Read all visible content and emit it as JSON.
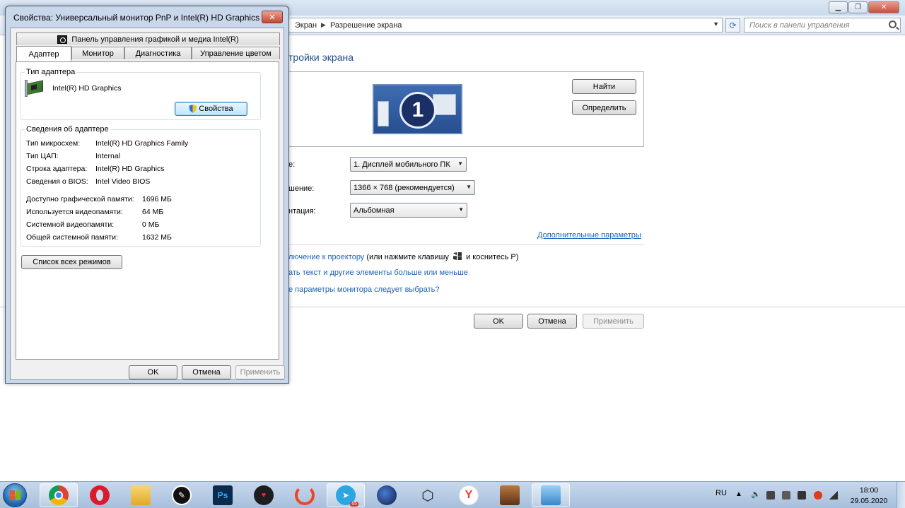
{
  "control_panel": {
    "breadcrumb": [
      "Экран",
      "Разрешение экрана"
    ],
    "search_placeholder": "Поиск в панели управления",
    "heading": "тройки экрана",
    "monitor_number": "1",
    "find_label": "Найти",
    "identify_label": "Определить",
    "display_label": "е:",
    "display_value": "1. Дисплей мобильного ПК",
    "resolution_label": "шение:",
    "resolution_value": "1366 × 768 (рекомендуется)",
    "orientation_label": "нтация:",
    "orientation_value": "Альбомная",
    "advanced_link": "Дополнительные параметры",
    "projector_link": "лючение к проектору",
    "projector_hint_before": "(или нажмите клавишу",
    "projector_hint_after": "и коснитесь P)",
    "text_size_link": "ать текст и другие элементы больше или меньше",
    "monitor_settings_link": "е параметры монитора следует выбрать?",
    "ok_label": "OK",
    "cancel_label": "Отмена",
    "apply_label": "Применить"
  },
  "dialog": {
    "title": "Свойства: Универсальный монитор PnP и Intel(R) HD Graphics",
    "close_label": "✕",
    "top_tab": "Панель управления графикой и медиа Intel(R)",
    "tabs": [
      "Адаптер",
      "Монитор",
      "Диагностика",
      "Управление цветом"
    ],
    "adapter_type_title": "Тип адаптера",
    "adapter_name": "Intel(R) HD Graphics",
    "properties_label": "Свойства",
    "adapter_info_title": "Сведения об адаптере",
    "info": [
      {
        "label": "Тип микросхем:",
        "value": "Intel(R) HD Graphics Family"
      },
      {
        "label": "Тип ЦАП:",
        "value": "Internal"
      },
      {
        "label": "Строка адаптера:",
        "value": "Intel(R) HD Graphics"
      },
      {
        "label": "Сведения о BIOS:",
        "value": "Intel Video BIOS"
      }
    ],
    "memory": [
      {
        "label": "Доступно графической памяти:",
        "value": "1696 МБ"
      },
      {
        "label": "Используется видеопамяти:",
        "value": "64 МБ"
      },
      {
        "label": "Системной видеопамяти:",
        "value": "0 МБ"
      },
      {
        "label": "Общей системной памяти:",
        "value": "1632 МБ"
      }
    ],
    "list_modes_label": "Список всех режимов",
    "ok_label": "OK",
    "cancel_label": "Отмена",
    "apply_label": "Применить"
  },
  "taskbar": {
    "telegram_badge": "65",
    "language": "RU",
    "time": "18:00",
    "date": "29.05.2020"
  }
}
